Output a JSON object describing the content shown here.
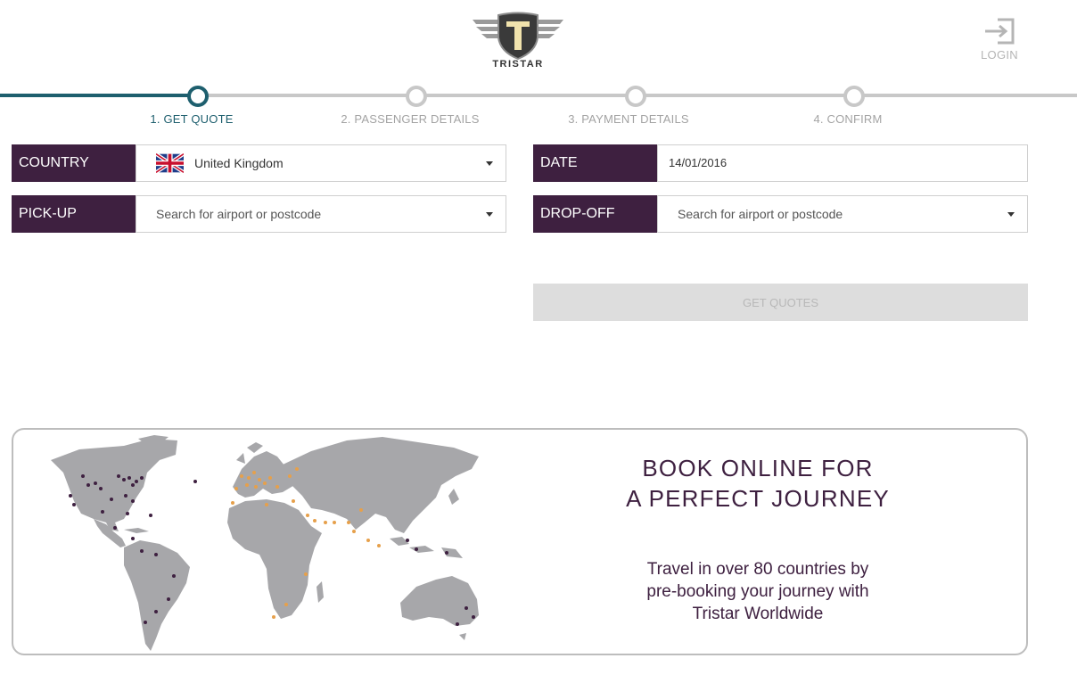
{
  "brand": {
    "name": "TRISTAR",
    "logo_icon": "tristar-winged-shield-logo"
  },
  "header": {
    "login_label": "LOGIN",
    "login_icon": "login-arrow-icon"
  },
  "progress": {
    "current_step": 1,
    "steps": [
      {
        "label": "1. GET QUOTE"
      },
      {
        "label": "2. PASSENGER DETAILS"
      },
      {
        "label": "3. PAYMENT DETAILS"
      },
      {
        "label": "4. CONFIRM"
      }
    ]
  },
  "form": {
    "country": {
      "label": "COUNTRY",
      "value": "United Kingdom",
      "flag_icon": "uk-flag-icon"
    },
    "date": {
      "label": "DATE",
      "value": "14/01/2016"
    },
    "pickup": {
      "label": "PICK-UP",
      "placeholder": "Search for airport or postcode"
    },
    "dropoff": {
      "label": "DROP-OFF",
      "placeholder": "Search for airport or postcode"
    },
    "submit_label": "GET QUOTES"
  },
  "banner": {
    "title_line1": "BOOK ONLINE FOR",
    "title_line2": "A PERFECT JOURNEY",
    "desc_line1": "Travel in over 80 countries by",
    "desc_line2": "pre-booking your journey with",
    "desc_line3": "Tristar Worldwide",
    "map_icon": "world-coverage-map"
  },
  "colors": {
    "accent_teal": "#1e5f6e",
    "label_purple": "#3e2040",
    "inactive_grey": "#c8c8c8",
    "map_land": "#a7a7aa",
    "map_dot_dark": "#3e2040",
    "map_dot_orange": "#e6a04b"
  }
}
